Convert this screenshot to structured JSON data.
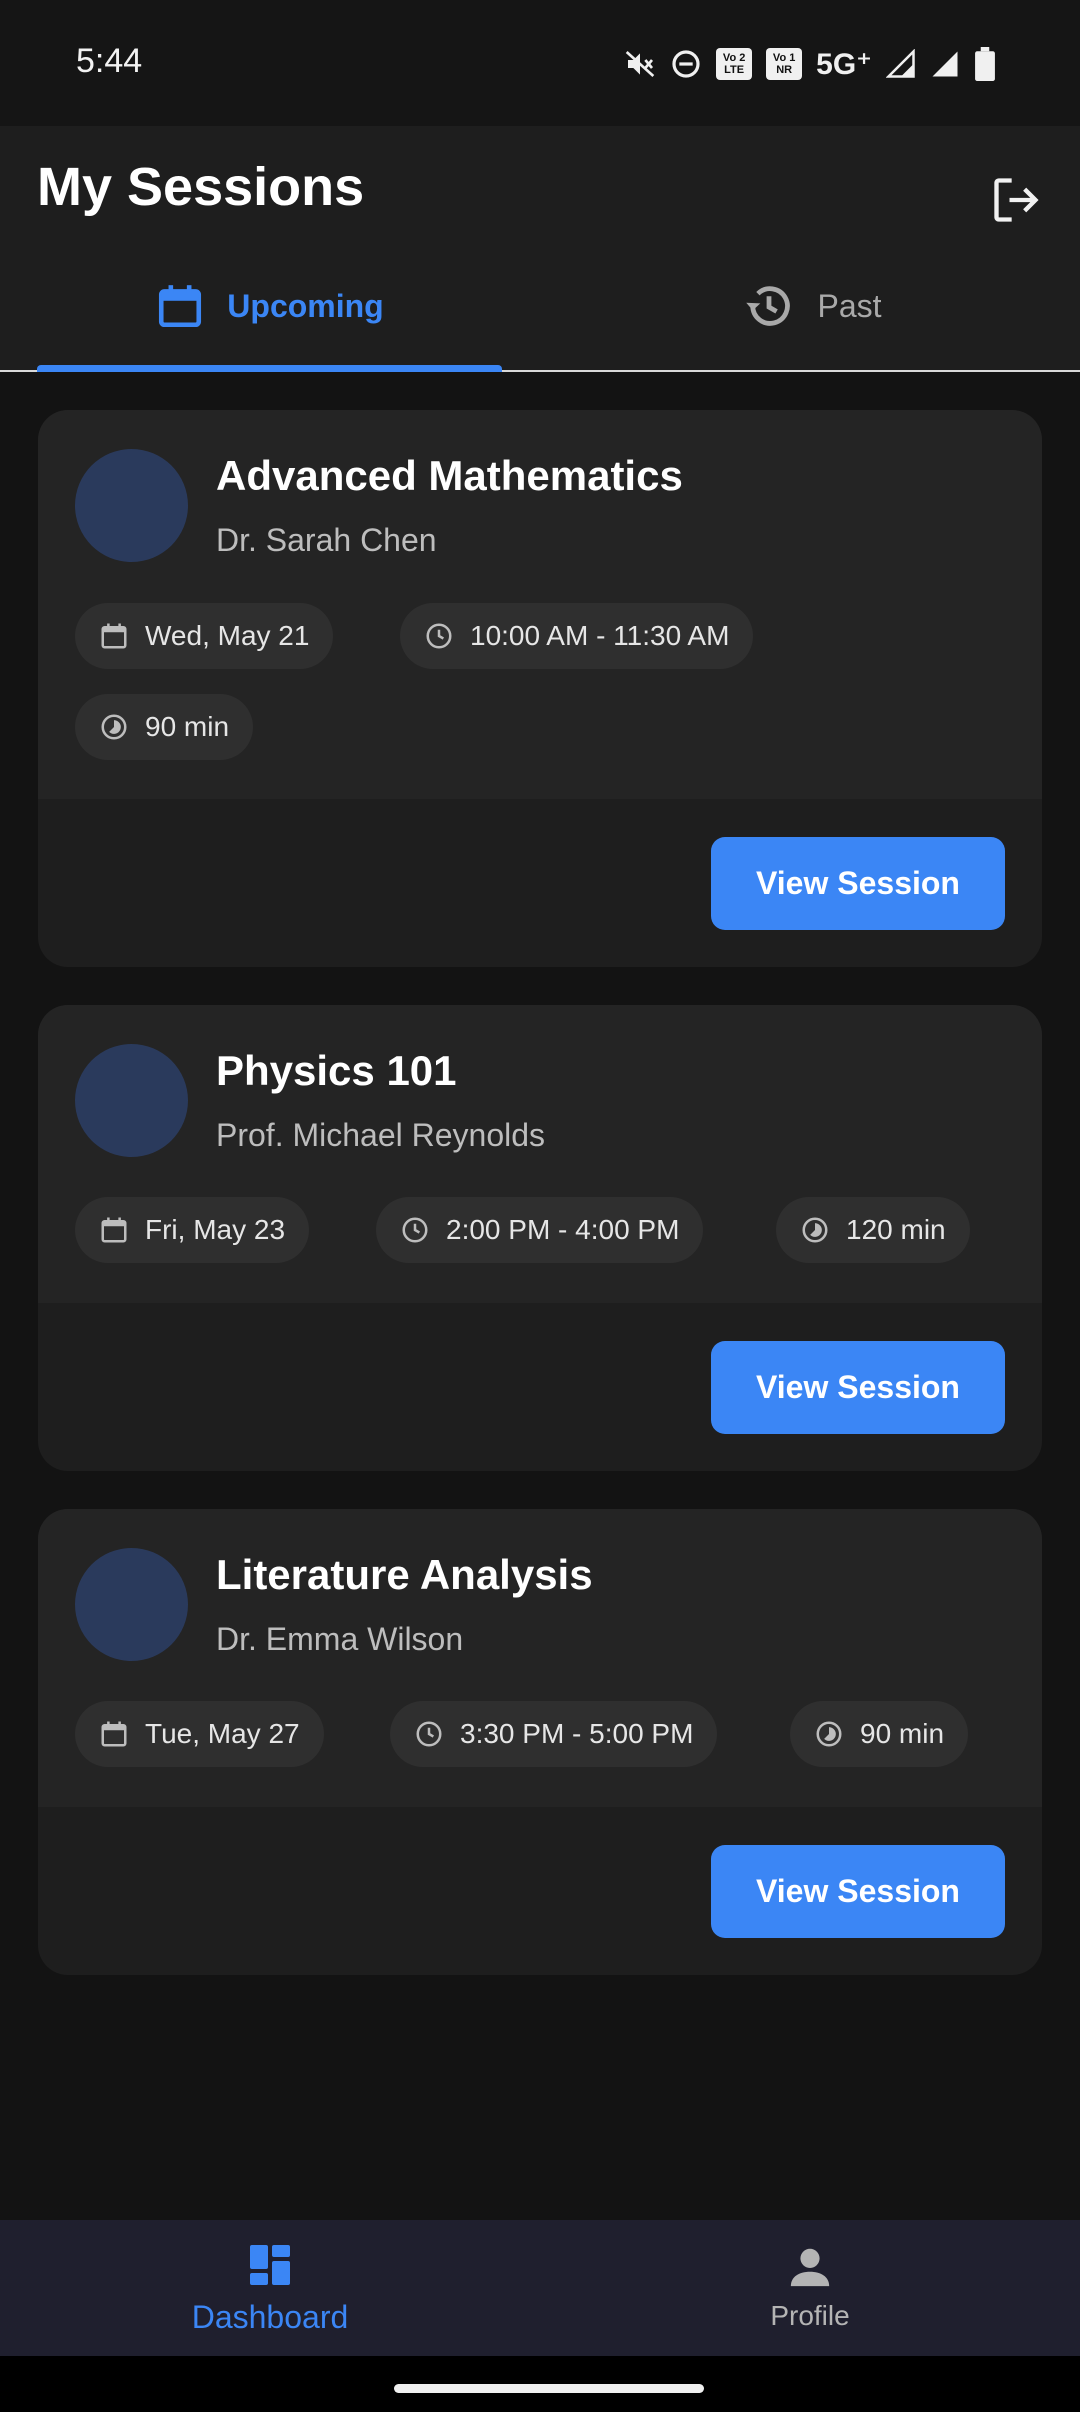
{
  "status_bar": {
    "time": "5:44",
    "network": "5G⁺",
    "volte1": [
      "Vo 2",
      "LTE"
    ],
    "volte2": [
      "Vo 1",
      "NR"
    ]
  },
  "header": {
    "title": "My Sessions"
  },
  "tabs": [
    {
      "label": "Upcoming",
      "icon": "calendar-icon",
      "selected": true
    },
    {
      "label": "Past",
      "icon": "history-icon",
      "selected": false
    }
  ],
  "sessions": [
    {
      "title": "Advanced Mathematics",
      "instructor": "Dr. Sarah Chen",
      "date": "Wed, May 21",
      "time": "10:00 AM - 11:30 AM",
      "duration": "90 min",
      "button": "View Session"
    },
    {
      "title": "Physics 101",
      "instructor": "Prof. Michael Reynolds",
      "date": "Fri, May 23",
      "time": "2:00 PM - 4:00 PM",
      "duration": "120 min",
      "button": "View Session"
    },
    {
      "title": "Literature Analysis",
      "instructor": "Dr. Emma Wilson",
      "date": "Tue, May 27",
      "time": "3:30 PM - 5:00 PM",
      "duration": "90 min",
      "button": "View Session"
    }
  ],
  "bottom_nav": [
    {
      "label": "Dashboard",
      "icon": "dashboard-icon",
      "selected": true
    },
    {
      "label": "Profile",
      "icon": "person-icon",
      "selected": false
    }
  ],
  "colors": {
    "accent": "#3b86f5",
    "background": "#131313",
    "card": "#1e1e1e",
    "avatar": "#2a3a5c"
  }
}
